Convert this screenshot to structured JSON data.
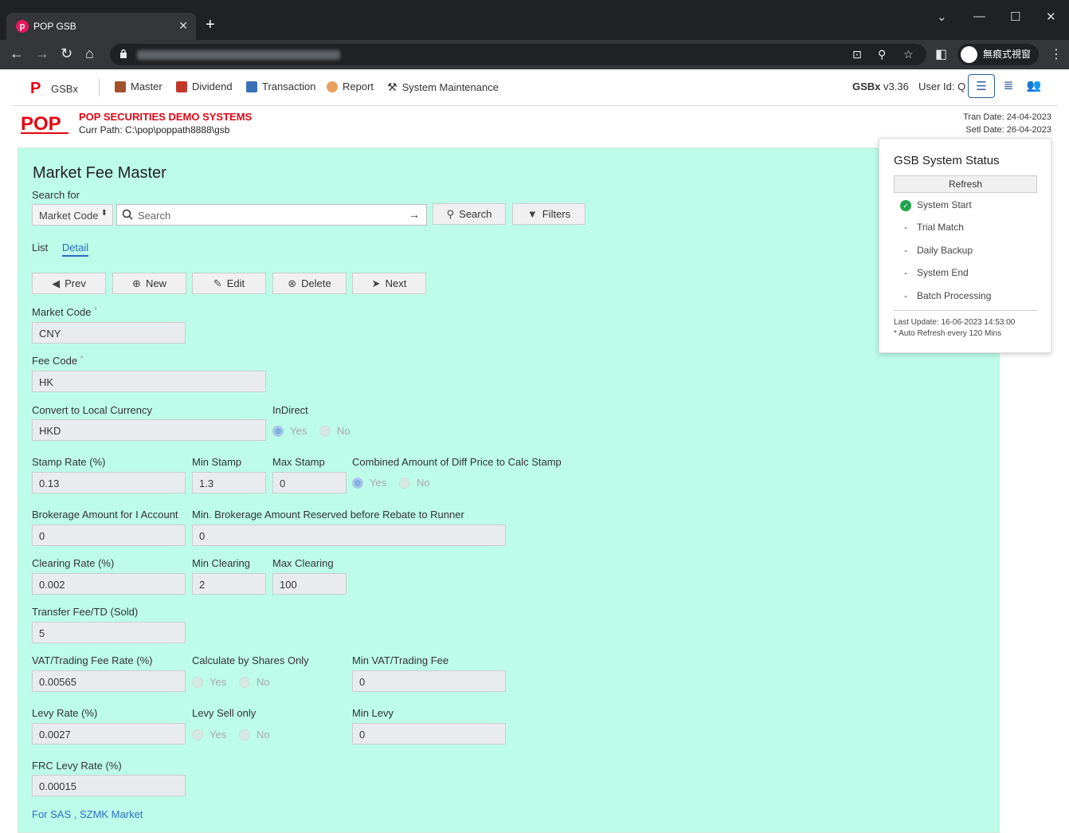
{
  "browser": {
    "tab_title": "POP GSB",
    "new_tab": "+",
    "incognito_label": "無痕式視窗"
  },
  "nav": {
    "brand": "GSBx",
    "menu": [
      {
        "label": "Master"
      },
      {
        "label": "Dividend"
      },
      {
        "label": "Transaction"
      },
      {
        "label": "Report"
      },
      {
        "label": "System Maintenance"
      }
    ],
    "app_name": "GSBx",
    "version": "v3.36",
    "user_id_label": "User Id: Q"
  },
  "header": {
    "company": "POP SECURITIES DEMO SYSTEMS",
    "curr_path": "Curr Path: C:\\pop\\poppath8888\\gsb",
    "tran_date": "Tran Date: 24-04-2023",
    "setl_date": "Setl Date: 26-04-2023"
  },
  "page": {
    "title": "Market Fee Master",
    "search_for_label": "Search for",
    "search_field_select": "Market Code",
    "search_placeholder": "Search",
    "search_button": "Search",
    "filters_button": "Filters",
    "tabs": [
      "List",
      "Detail"
    ],
    "actions": {
      "prev": "Prev",
      "new": "New",
      "edit": "Edit",
      "delete": "Delete",
      "next": "Next"
    }
  },
  "form": {
    "market_code_label": "Market Code",
    "market_code": "CNY",
    "fee_code_label": "Fee Code",
    "fee_code": "HK",
    "convert_label": "Convert to Local Currency",
    "convert": "HKD",
    "indirect_label": "InDirect",
    "yes": "Yes",
    "no": "No",
    "stamp_rate_label": "Stamp Rate (%)",
    "stamp_rate": "0.13",
    "min_stamp_label": "Min Stamp",
    "min_stamp": "1.3",
    "max_stamp_label": "Max Stamp",
    "max_stamp": "0",
    "combined_label": "Combined Amount of Diff Price to Calc Stamp",
    "brokerage_label": "Brokerage Amount for I Account",
    "brokerage": "0",
    "min_brokerage_label": "Min. Brokerage Amount Reserved before Rebate to Runner",
    "min_brokerage": "0",
    "clearing_rate_label": "Clearing Rate (%)",
    "clearing_rate": "0.002",
    "min_clearing_label": "Min Clearing",
    "min_clearing": "2",
    "max_clearing_label": "Max Clearing",
    "max_clearing": "100",
    "transfer_fee_label": "Transfer Fee/TD (Sold)",
    "transfer_fee": "5",
    "vat_rate_label": "VAT/Trading Fee Rate (%)",
    "vat_rate": "0.00565",
    "calc_shares_label": "Calculate by Shares Only",
    "min_vat_label": "Min VAT/Trading Fee",
    "min_vat": "0",
    "levy_rate_label": "Levy Rate (%)",
    "levy_rate": "0.0027",
    "levy_sell_label": "Levy Sell only",
    "min_levy_label": "Min Levy",
    "min_levy": "0",
    "frc_levy_label": "FRC Levy Rate (%)",
    "frc_levy": "0.00015",
    "sas_link": "For SAS , SZMK Market"
  },
  "status": {
    "title": "GSB System Status",
    "refresh": "Refresh",
    "items": [
      {
        "label": "System Start",
        "state": "done"
      },
      {
        "label": "Trial Match",
        "state": "pending"
      },
      {
        "label": "Daily Backup",
        "state": "pending"
      },
      {
        "label": "System End",
        "state": "pending"
      },
      {
        "label": "Batch Processing",
        "state": "pending"
      }
    ],
    "last_update": "Last Update: 16-06-2023 14:53:00",
    "auto_refresh": "* Auto Refresh every 120 Mins"
  },
  "colors": {
    "panel_bg": "#bdfce8",
    "brand_red": "#e20613",
    "link_blue": "#2c6bc7"
  }
}
